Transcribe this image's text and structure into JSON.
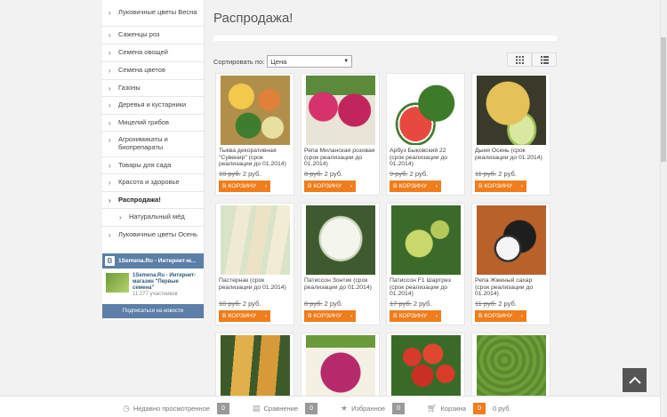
{
  "sidebar": {
    "items": [
      {
        "label": "Луковичные цветы Весна"
      },
      {
        "label": "Саженцы роз"
      },
      {
        "label": "Семена овощей"
      },
      {
        "label": "Семена цветов"
      },
      {
        "label": "Газоны"
      },
      {
        "label": "Деревья и кустарники"
      },
      {
        "label": "Мицелий грибов"
      },
      {
        "label": "Агрохимикаты и биопрепараты"
      },
      {
        "label": "Товары для сада"
      },
      {
        "label": "Красота и здоровье"
      },
      {
        "label": "Распродажа!"
      },
      {
        "label": "Натуральный мёд"
      },
      {
        "label": "Луковичные цветы Осень"
      }
    ]
  },
  "vk_widget": {
    "header": "1Semena.Ru - Интернет-м...",
    "group_name": "1Semena.Ru - Интернет-магазин \"Первые семена\"",
    "members": "11 277 участников",
    "subscribe_label": "Подписаться на новости",
    "logo_letter": "В"
  },
  "main": {
    "title": "Распродажа!",
    "sort_label": "Сортировать по:",
    "sort_value": "Цена"
  },
  "products": [
    {
      "name": "Тыква декоративная \"Сувенир\" (срок реализации до 01.2014)",
      "old_price": "10 руб.",
      "new_price": "2 руб.",
      "button": "В КОРЗИНУ"
    },
    {
      "name": "Репа Миланская розовая (срок реализации до 01.2014)",
      "old_price": "8 руб.",
      "new_price": "2 руб.",
      "button": "В КОРЗИНУ"
    },
    {
      "name": "Арбуз Быковский 22 (срок реализации до 01.2014)",
      "old_price": "9 руб.",
      "new_price": "2 руб.",
      "button": "В КОРЗИНУ"
    },
    {
      "name": "Дыня Осень (срок реализации до 01.2014)",
      "old_price": "11 руб.",
      "new_price": "2 руб.",
      "button": "В КОРЗИНУ"
    },
    {
      "name": "Пастернак (срок реализации до 01.2014)",
      "old_price": "10 руб.",
      "new_price": "2 руб.",
      "button": "В КОРЗИНУ"
    },
    {
      "name": "Патиссон Зонтик (срок реализации до 01.2014)",
      "old_price": "8 руб.",
      "new_price": "2 руб.",
      "button": "В КОРЗИНУ"
    },
    {
      "name": "Патиссон F1 Шартрез (срок реализации до 01.2014)",
      "old_price": "17 руб.",
      "new_price": "2 руб.",
      "button": "В КОРЗИНУ"
    },
    {
      "name": "Репа Жженый сахар (срок реализации до 01.2014)",
      "old_price": "11 руб.",
      "new_price": "2 руб.",
      "button": "В КОРЗИНУ"
    }
  ],
  "bottom_bar": {
    "recent_label": "Недавно просмотренное",
    "recent_count": "0",
    "compare_label": "Сравнение",
    "compare_count": "0",
    "favorites_label": "Избранное",
    "favorites_count": "0",
    "cart_label": "Корзина",
    "cart_count": "0",
    "cart_total": "0 руб."
  },
  "colors": {
    "accent": "#f07d1b",
    "vk": "#5b7fa6"
  }
}
